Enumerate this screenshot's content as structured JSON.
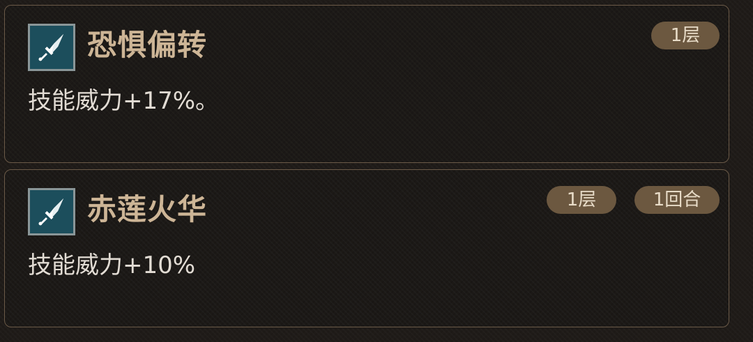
{
  "buffs": [
    {
      "icon": "sword-icon",
      "name": "恐惧偏转",
      "description": "技能威力+17%。",
      "stacks": "1层"
    },
    {
      "icon": "sword-icon",
      "name": "赤莲火华",
      "description": "技能威力+10%",
      "stacks": "1层",
      "duration": "1回合"
    }
  ],
  "colors": {
    "title": "#cdb596",
    "description": "#e2dcd4",
    "badge_bg": "#6c5840",
    "icon_bg": "#1c4e5c",
    "card_border": "#6b5a48"
  }
}
